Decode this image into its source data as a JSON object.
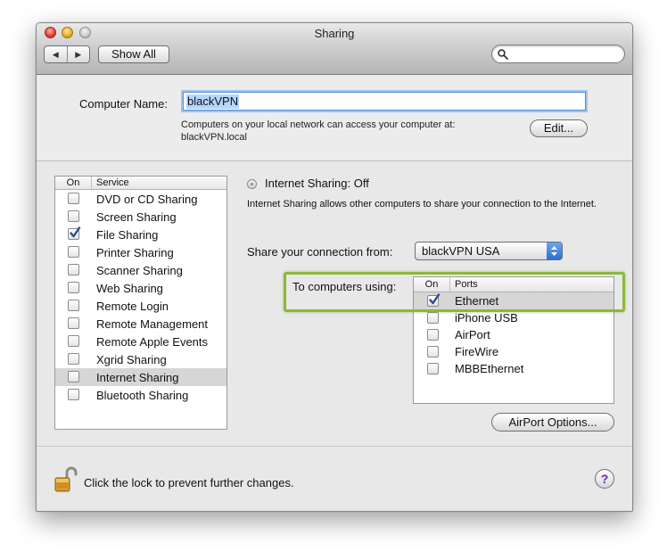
{
  "window": {
    "title": "Sharing",
    "show_all_label": "Show All",
    "search_placeholder": ""
  },
  "computer_name": {
    "label": "Computer Name:",
    "value": "blackVPN",
    "description_line1": "Computers on your local network can access your computer at:",
    "description_line2": "blackVPN.local",
    "edit_button": "Edit..."
  },
  "services": {
    "header_on": "On",
    "header_service": "Service",
    "items": [
      {
        "label": "DVD or CD Sharing",
        "checked": false
      },
      {
        "label": "Screen Sharing",
        "checked": false
      },
      {
        "label": "File Sharing",
        "checked": true
      },
      {
        "label": "Printer Sharing",
        "checked": false
      },
      {
        "label": "Scanner Sharing",
        "checked": false
      },
      {
        "label": "Web Sharing",
        "checked": false
      },
      {
        "label": "Remote Login",
        "checked": false
      },
      {
        "label": "Remote Management",
        "checked": false
      },
      {
        "label": "Remote Apple Events",
        "checked": false
      },
      {
        "label": "Xgrid Sharing",
        "checked": false
      },
      {
        "label": "Internet Sharing",
        "checked": false,
        "selected": true
      },
      {
        "label": "Bluetooth Sharing",
        "checked": false
      }
    ]
  },
  "internet_sharing": {
    "status": "Internet Sharing: Off",
    "description": "Internet Sharing allows other computers to share your connection to the Internet.",
    "share_from_label": "Share your connection from:",
    "share_from_value": "blackVPN USA",
    "to_computers_label": "To computers using:",
    "ports_header_on": "On",
    "ports_header_ports": "Ports",
    "ports": [
      {
        "label": "Ethernet",
        "checked": true,
        "selected": true
      },
      {
        "label": "iPhone USB",
        "checked": false
      },
      {
        "label": "AirPort",
        "checked": false
      },
      {
        "label": "FireWire",
        "checked": false
      },
      {
        "label": "MBBEthernet",
        "checked": false
      }
    ],
    "airport_options_button": "AirPort Options..."
  },
  "footer": {
    "lock_text": "Click the lock to prevent further changes.",
    "help_label": "?"
  },
  "colors": {
    "highlight_box": "#8cb83a",
    "selection_text_bg": "#b5d5ff",
    "checkmark": "#2a4f8a"
  }
}
